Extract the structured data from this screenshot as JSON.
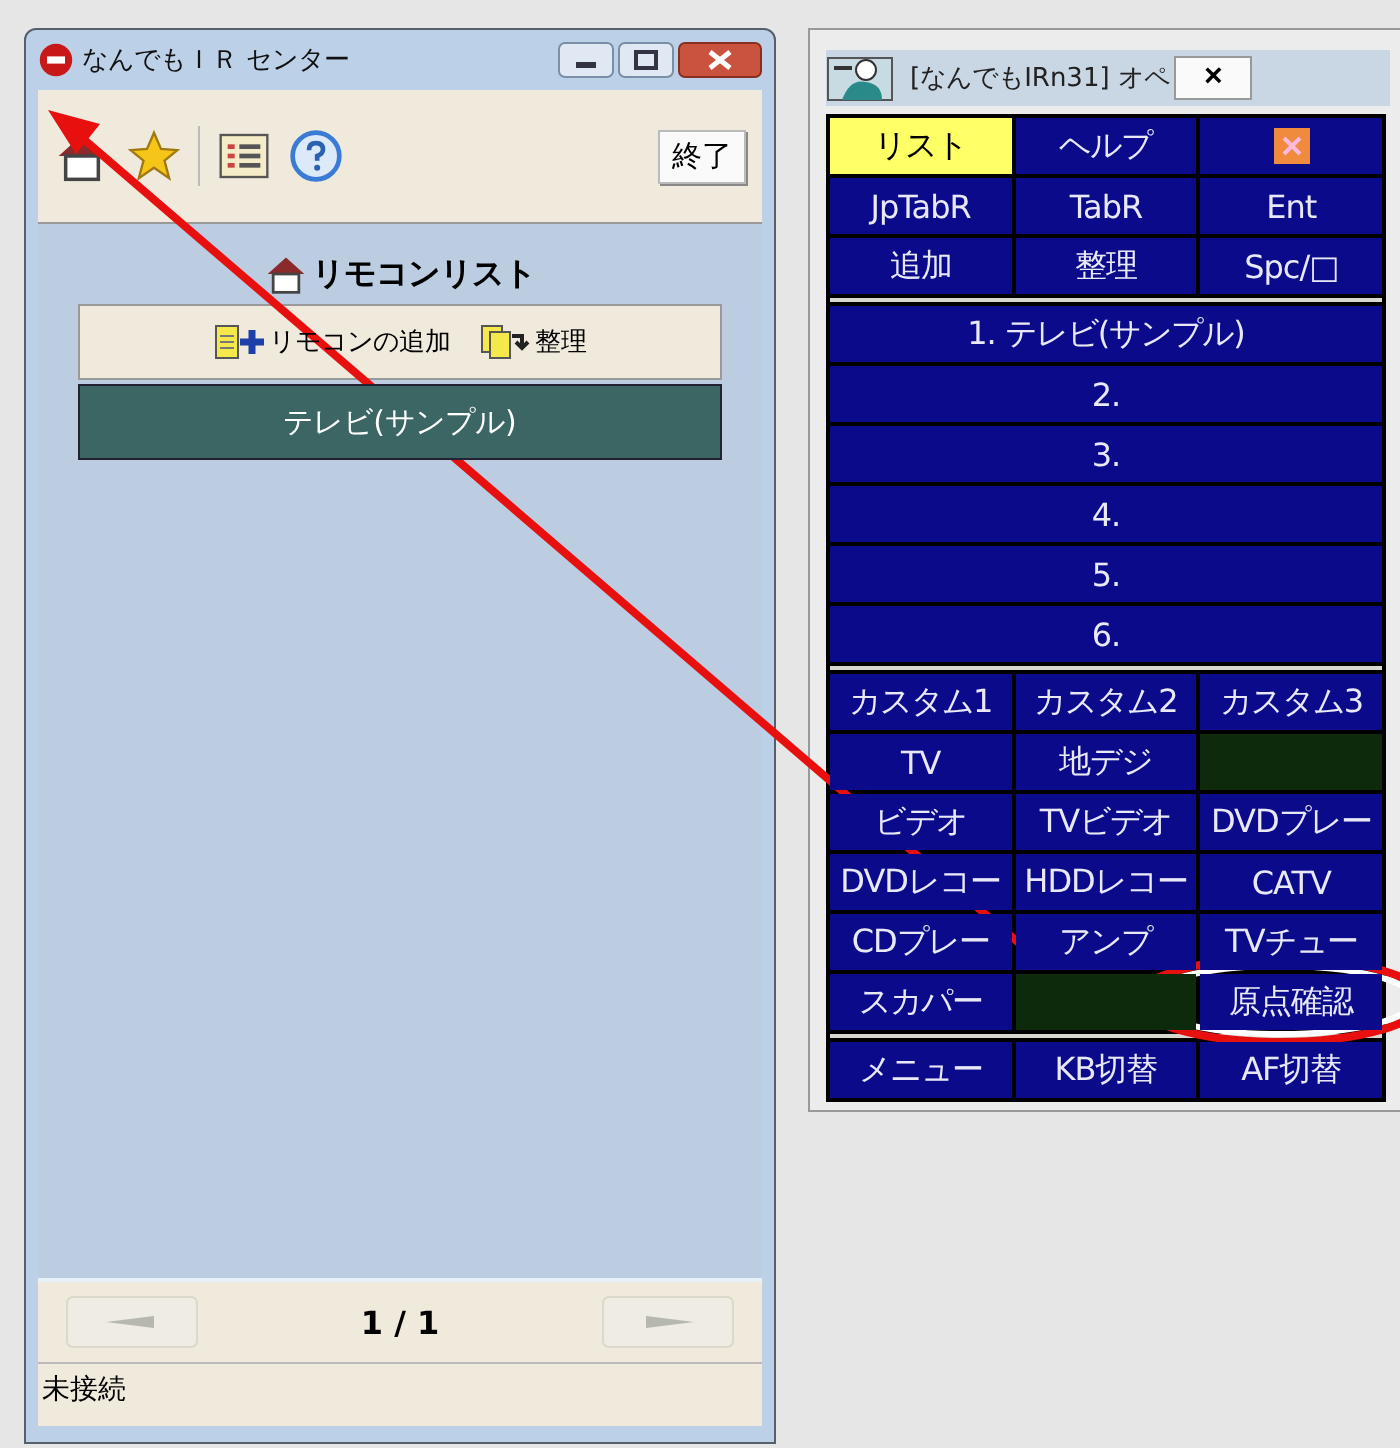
{
  "main_window": {
    "title": "なんでもＩＲ センター",
    "toolbar": {
      "exit_button": "終了"
    },
    "list_heading": "リモコンリスト",
    "actions": [
      {
        "label": "リモコンの追加",
        "kind": "add"
      },
      {
        "label": "整理",
        "kind": "organize"
      }
    ],
    "remotes": [
      {
        "label": "テレビ(サンプル)",
        "selected": true
      }
    ],
    "pager": {
      "page": "1 / 1",
      "prev_disabled": true,
      "next_disabled": true
    },
    "status_bar": "未接続"
  },
  "operator_window": {
    "title": "[なんでもIRn31] オペ",
    "close": "×",
    "top_buttons": [
      {
        "label": "リスト",
        "kind": "button",
        "selected": true
      },
      {
        "label": "ヘルプ",
        "kind": "button",
        "selected": false
      },
      {
        "kind": "icon",
        "selected": false
      },
      {
        "label": "JpTabR",
        "kind": "button",
        "selected": false
      },
      {
        "label": "TabR",
        "kind": "button",
        "selected": false
      },
      {
        "label": "Ent",
        "kind": "button",
        "selected": false
      },
      {
        "label": "追加",
        "kind": "button",
        "selected": false
      },
      {
        "label": "整理",
        "kind": "button",
        "selected": false
      },
      {
        "label": "Spc/□",
        "kind": "button",
        "selected": false
      }
    ],
    "slots": [
      "1. テレビ(サンプル)",
      "2.",
      "3.",
      "4.",
      "5.",
      "6."
    ],
    "devices": [
      {
        "label": "カスタム1",
        "kind": "button"
      },
      {
        "label": "カスタム2",
        "kind": "button"
      },
      {
        "label": "カスタム3",
        "kind": "button"
      },
      {
        "label": "TV",
        "kind": "button"
      },
      {
        "label": "地デジ",
        "kind": "button"
      },
      {
        "kind": "empty"
      },
      {
        "label": "ビデオ",
        "kind": "button"
      },
      {
        "label": "TVビデオ",
        "kind": "button"
      },
      {
        "label": "DVDプレー",
        "kind": "button"
      },
      {
        "label": "DVDレコー",
        "kind": "button"
      },
      {
        "label": "HDDレコー",
        "kind": "button"
      },
      {
        "label": "CATV",
        "kind": "button"
      },
      {
        "label": "CDプレー",
        "kind": "button"
      },
      {
        "label": "アンプ",
        "kind": "button"
      },
      {
        "label": "TVチュー",
        "kind": "button"
      },
      {
        "label": "スカパー",
        "kind": "button"
      },
      {
        "kind": "empty"
      },
      {
        "label": "原点確認",
        "kind": "button"
      }
    ],
    "bottom_buttons": [
      "メニュー",
      "KB切替",
      "AF切替"
    ]
  }
}
